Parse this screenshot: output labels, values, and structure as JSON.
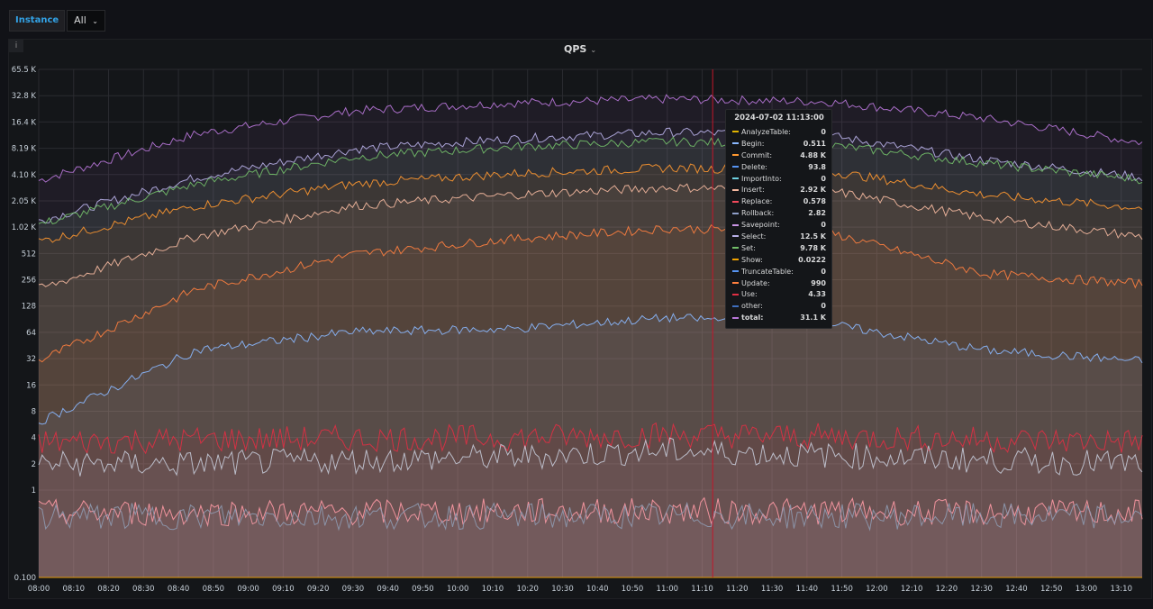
{
  "variables": {
    "label": "Instance",
    "value": "All",
    "caret": "⌄"
  },
  "panel": {
    "title": "QPS",
    "caret": "⌄",
    "info": "i"
  },
  "chart_data": {
    "type": "area",
    "title": "QPS",
    "y_scale": "log2",
    "ylim": [
      0.1,
      65536
    ],
    "y_ticks": [
      "0.100",
      "1",
      "2",
      "4",
      "8",
      "16",
      "32",
      "64",
      "128",
      "256",
      "512",
      "1.02 K",
      "2.05 K",
      "4.10 K",
      "8.19 K",
      "16.4 K",
      "32.8 K",
      "65.5 K"
    ],
    "y_tick_values": [
      0.1,
      1,
      2,
      4,
      8,
      16,
      32,
      64,
      128,
      256,
      512,
      1024,
      2048,
      4096,
      8192,
      16384,
      32768,
      65536
    ],
    "x_ticks": [
      "08:00",
      "08:10",
      "08:20",
      "08:30",
      "08:40",
      "08:50",
      "09:00",
      "09:10",
      "09:20",
      "09:30",
      "09:40",
      "09:50",
      "10:00",
      "10:10",
      "10:20",
      "10:30",
      "10:40",
      "10:50",
      "11:00",
      "11:10",
      "11:20",
      "11:30",
      "11:40",
      "11:50",
      "12:00",
      "12:10",
      "12:20",
      "12:30",
      "12:40",
      "12:50",
      "13:00",
      "13:10"
    ],
    "xlim": [
      "08:00",
      "13:16"
    ],
    "crosshair_time": "11:13",
    "grid": true,
    "legend": "tooltip",
    "series": [
      {
        "name": "total",
        "color": "#b877d9",
        "profile": [
          3500,
          12000,
          22000,
          27000,
          30000,
          28000,
          18000,
          9500
        ]
      },
      {
        "name": "Select",
        "color": "#b8b0e8",
        "profile": [
          1200,
          3800,
          8000,
          10500,
          12500,
          11500,
          6000,
          3800
        ]
      },
      {
        "name": "Set",
        "color": "#73bf69",
        "profile": [
          1100,
          3200,
          6500,
          8500,
          9800,
          9000,
          5500,
          3600
        ]
      },
      {
        "name": "Commit",
        "color": "#ff9830",
        "profile": [
          700,
          1800,
          3200,
          4200,
          4880,
          4500,
          2400,
          1700
        ]
      },
      {
        "name": "Insert",
        "color": "#f5b9a0",
        "profile": [
          200,
          800,
          1800,
          2400,
          2920,
          2700,
          1300,
          800
        ]
      },
      {
        "name": "Update",
        "color": "#ff7f3f",
        "profile": [
          30,
          200,
          500,
          750,
          990,
          900,
          300,
          230
        ]
      },
      {
        "name": "Delete",
        "color": "#8ab8ff",
        "profile": [
          6,
          40,
          65,
          70,
          93.8,
          80,
          40,
          30
        ]
      },
      {
        "name": "Use",
        "color": "#e02f44",
        "profile": [
          3.5,
          3.8,
          3.9,
          4.0,
          4.33,
          4.1,
          3.8,
          3.6
        ]
      },
      {
        "name": "Rollback",
        "color": "#c4c9d6",
        "profile": [
          2,
          2,
          2.2,
          2.4,
          2.82,
          2.5,
          2.2,
          2
        ]
      },
      {
        "name": "Replace",
        "color": "#ff9aa5",
        "profile": [
          0.55,
          0.55,
          0.56,
          0.57,
          0.578,
          0.57,
          0.55,
          0.55
        ]
      },
      {
        "name": "Begin",
        "color": "#8e9ab0",
        "profile": [
          0.5,
          0.5,
          0.5,
          0.5,
          0.511,
          0.5,
          0.5,
          0.5
        ]
      },
      {
        "name": "Show",
        "color": "#f2a400",
        "profile": [
          0.02,
          0.02,
          0.02,
          0.02,
          0.0222,
          0.02,
          0.02,
          0.02
        ]
      }
    ],
    "hover": {
      "time": "2024-07-02 11:13:00",
      "rows": [
        {
          "name": "AnalyzeTable:",
          "value": "0",
          "color": "#e0b400"
        },
        {
          "name": "Begin:",
          "value": "0.511",
          "color": "#8ab8ff"
        },
        {
          "name": "Commit:",
          "value": "4.88 K",
          "color": "#ff9830"
        },
        {
          "name": "Delete:",
          "value": "93.8",
          "color": "#5794f2"
        },
        {
          "name": "ImportInto:",
          "value": "0",
          "color": "#6ed0e0"
        },
        {
          "name": "Insert:",
          "value": "2.92 K",
          "color": "#f5b9a0"
        },
        {
          "name": "Replace:",
          "value": "0.578",
          "color": "#f2495c"
        },
        {
          "name": "Rollback:",
          "value": "2.82",
          "color": "#8f9fc9"
        },
        {
          "name": "Savepoint:",
          "value": "0",
          "color": "#ca95e5"
        },
        {
          "name": "Select:",
          "value": "12.5 K",
          "color": "#b8b0e8"
        },
        {
          "name": "Set:",
          "value": "9.78 K",
          "color": "#73bf69"
        },
        {
          "name": "Show:",
          "value": "0.0222",
          "color": "#f2a400"
        },
        {
          "name": "TruncateTable:",
          "value": "0",
          "color": "#5794f2"
        },
        {
          "name": "Update:",
          "value": "990",
          "color": "#ff7f3f"
        },
        {
          "name": "Use:",
          "value": "4.33",
          "color": "#e02f44"
        },
        {
          "name": "other:",
          "value": "0",
          "color": "#3f6fbf"
        },
        {
          "name": "total:",
          "value": "31.1 K",
          "color": "#b877d9"
        }
      ]
    }
  }
}
